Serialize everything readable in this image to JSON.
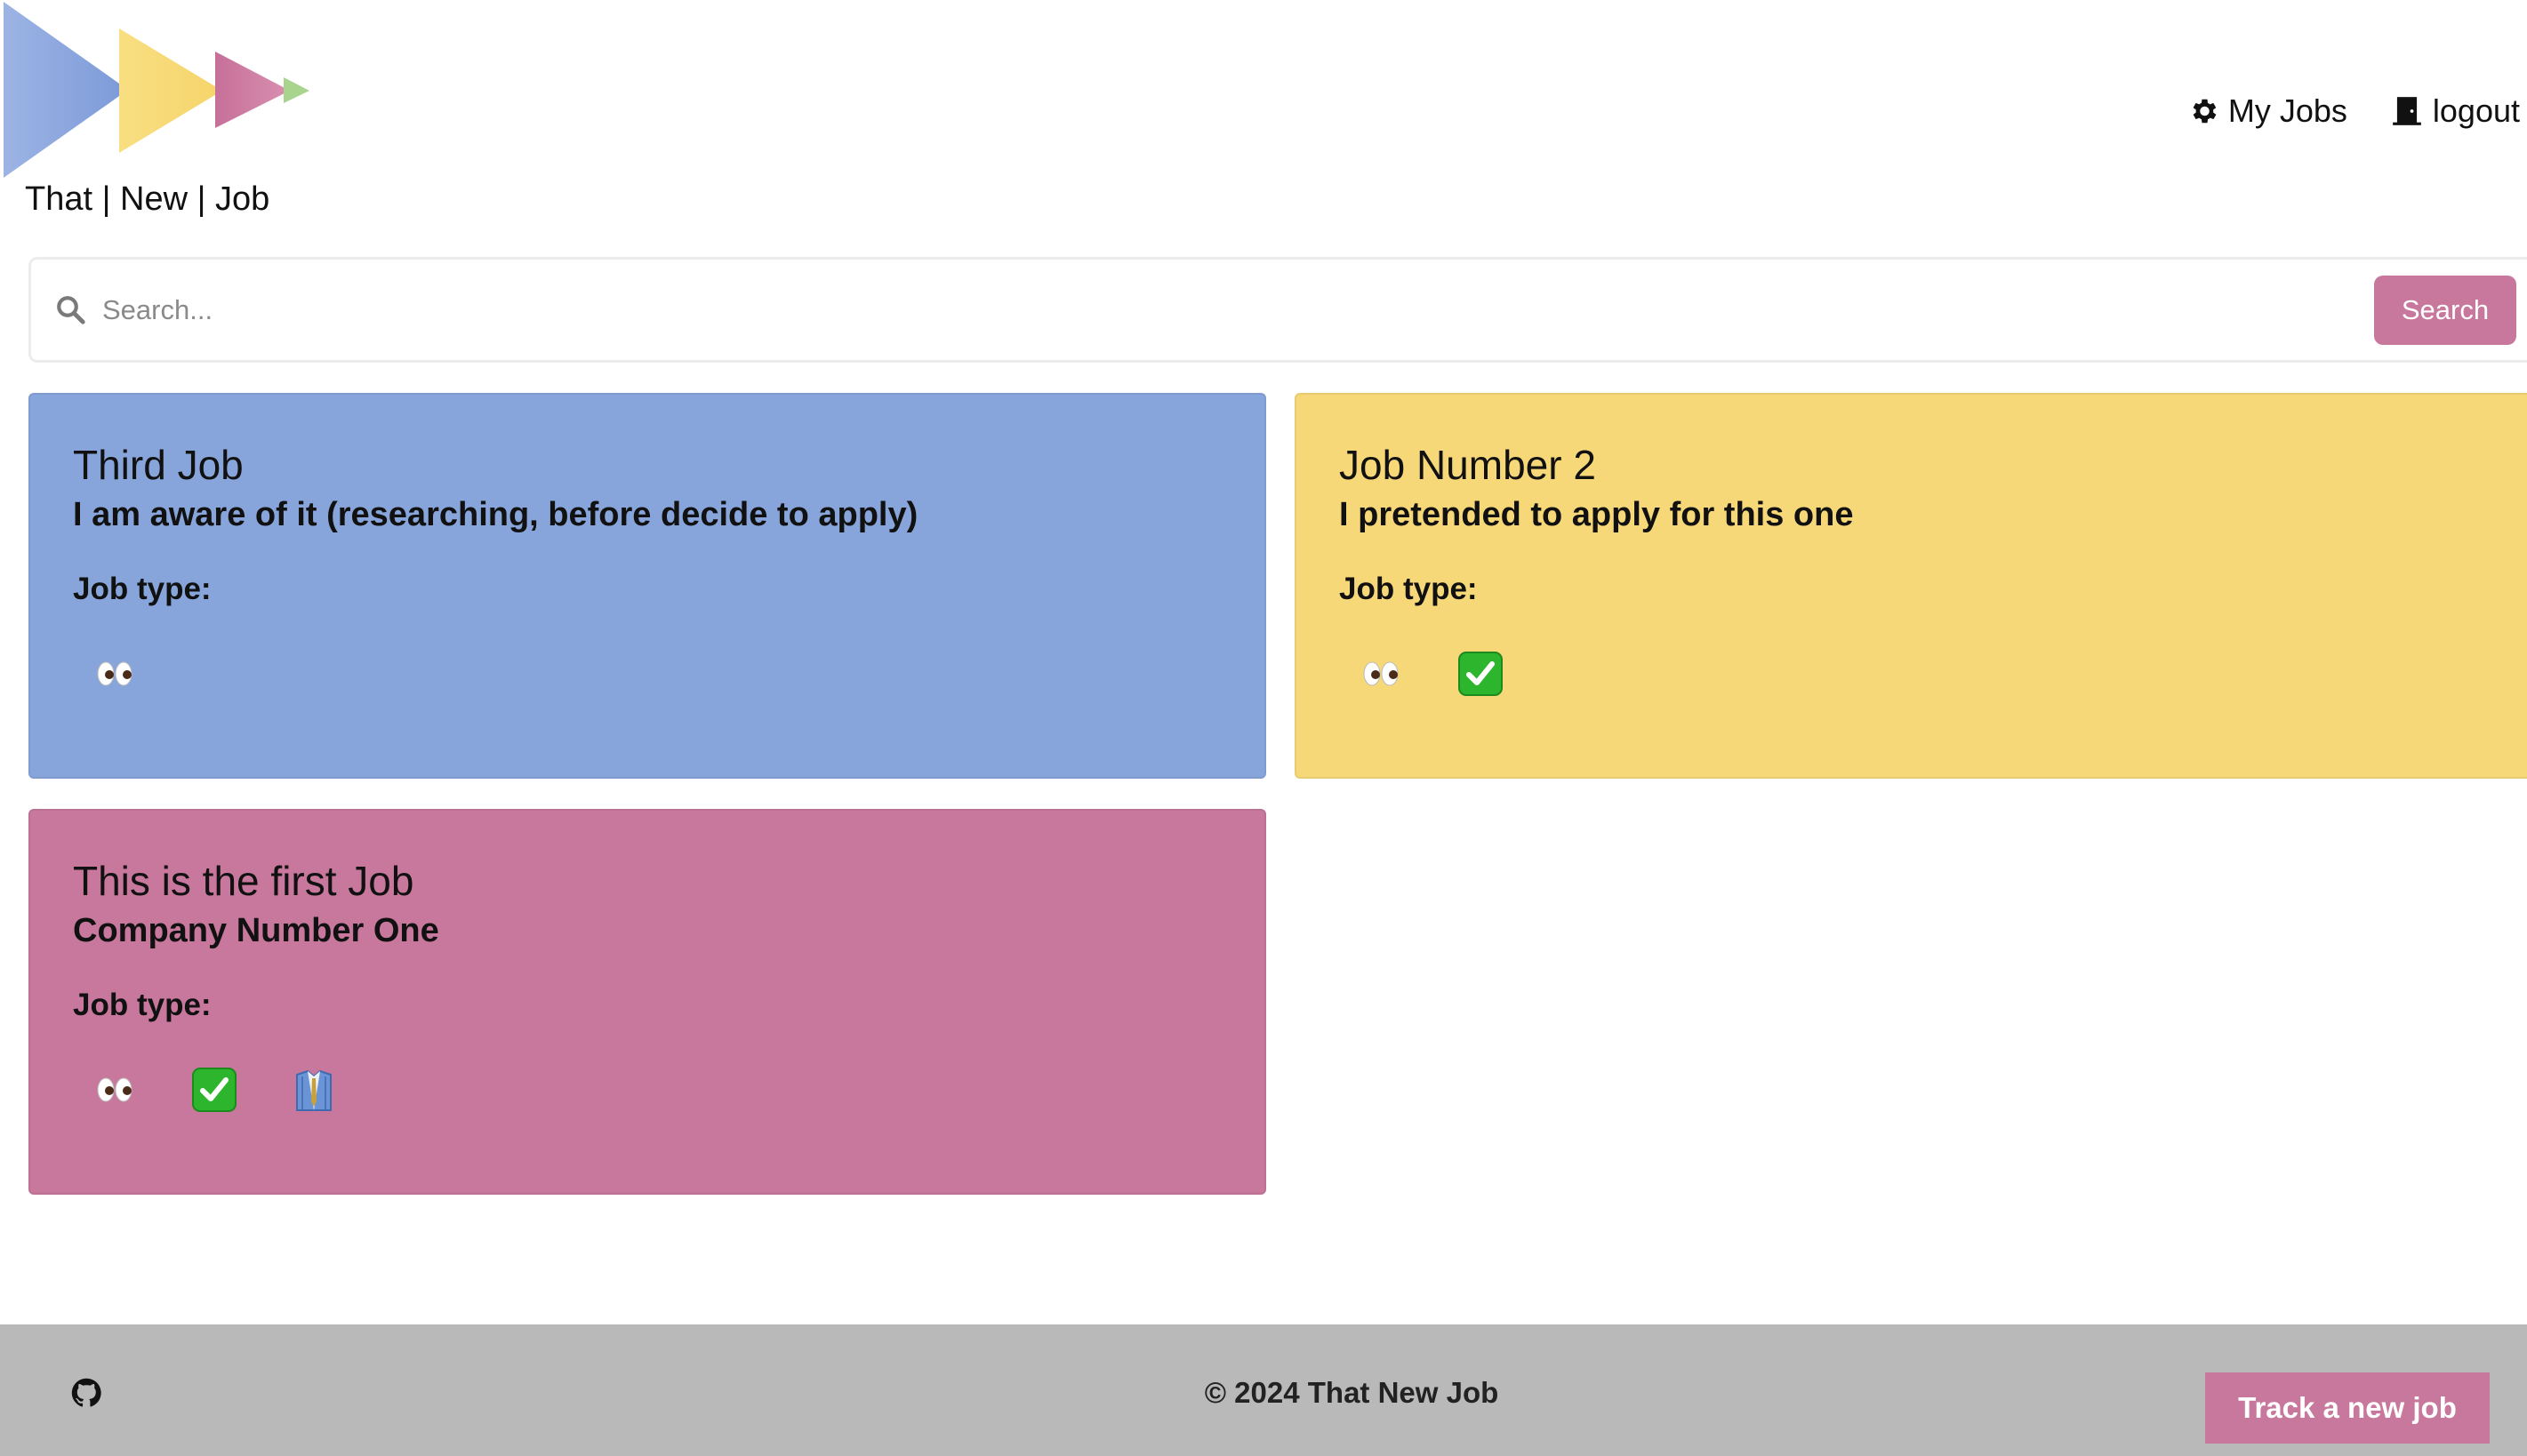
{
  "header": {
    "brand": "That | New | Job",
    "nav": [
      {
        "label": "My Jobs",
        "icon": "gear-icon"
      },
      {
        "label": "logout",
        "icon": "door-icon"
      }
    ]
  },
  "search": {
    "placeholder": "Search...",
    "value": "",
    "button_label": "Search"
  },
  "jobs": [
    {
      "title": "Third Job",
      "company": "I am aware of it (researching, before decide to apply)",
      "type_label": "Job type:",
      "color": "#87a5db",
      "statuses": [
        "eyes-icon"
      ]
    },
    {
      "title": "Job Number 2",
      "company": "I pretended to apply for this one",
      "type_label": "Job type:",
      "color": "#f7d878",
      "statuses": [
        "eyes-icon",
        "check-mark-icon"
      ]
    },
    {
      "title": "This is the first Job",
      "company": "Company Number One",
      "type_label": "Job type:",
      "color": "#c8789d",
      "statuses": [
        "eyes-icon",
        "check-mark-icon",
        "suit-icon"
      ]
    }
  ],
  "footer": {
    "copyright": "© 2024 That New Job",
    "track_button": "Track a new job",
    "icon": "github-icon"
  },
  "colors": {
    "accent": "#c7789c",
    "footer_bg": "#b9b9b9"
  }
}
